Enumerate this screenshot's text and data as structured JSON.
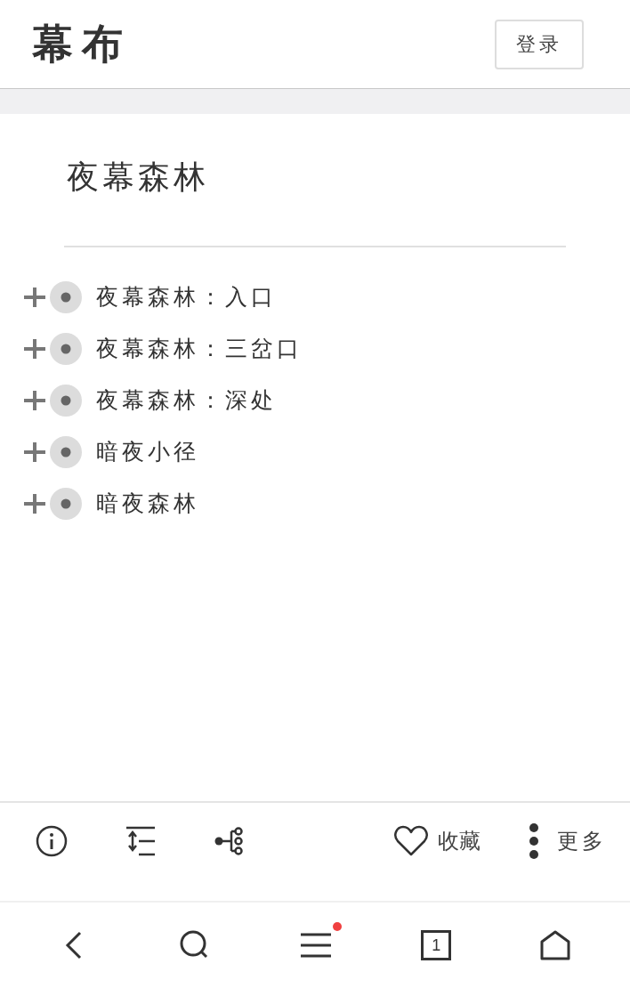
{
  "header": {
    "brand": "幕布",
    "login_button": "登录"
  },
  "document": {
    "title": "夜幕森林",
    "items": [
      {
        "text": "夜幕森林：入口",
        "expanded": false
      },
      {
        "text": "夜幕森林：三岔口",
        "expanded": false
      },
      {
        "text": "夜幕森林：深处",
        "expanded": false
      },
      {
        "text": "暗夜小径",
        "expanded": false
      },
      {
        "text": "暗夜森林",
        "expanded": false
      }
    ]
  },
  "toolbar": {
    "favorite_label": "收藏",
    "more_label": "更多"
  },
  "browser_nav": {
    "menu_notification": true,
    "tab_count": "1"
  }
}
